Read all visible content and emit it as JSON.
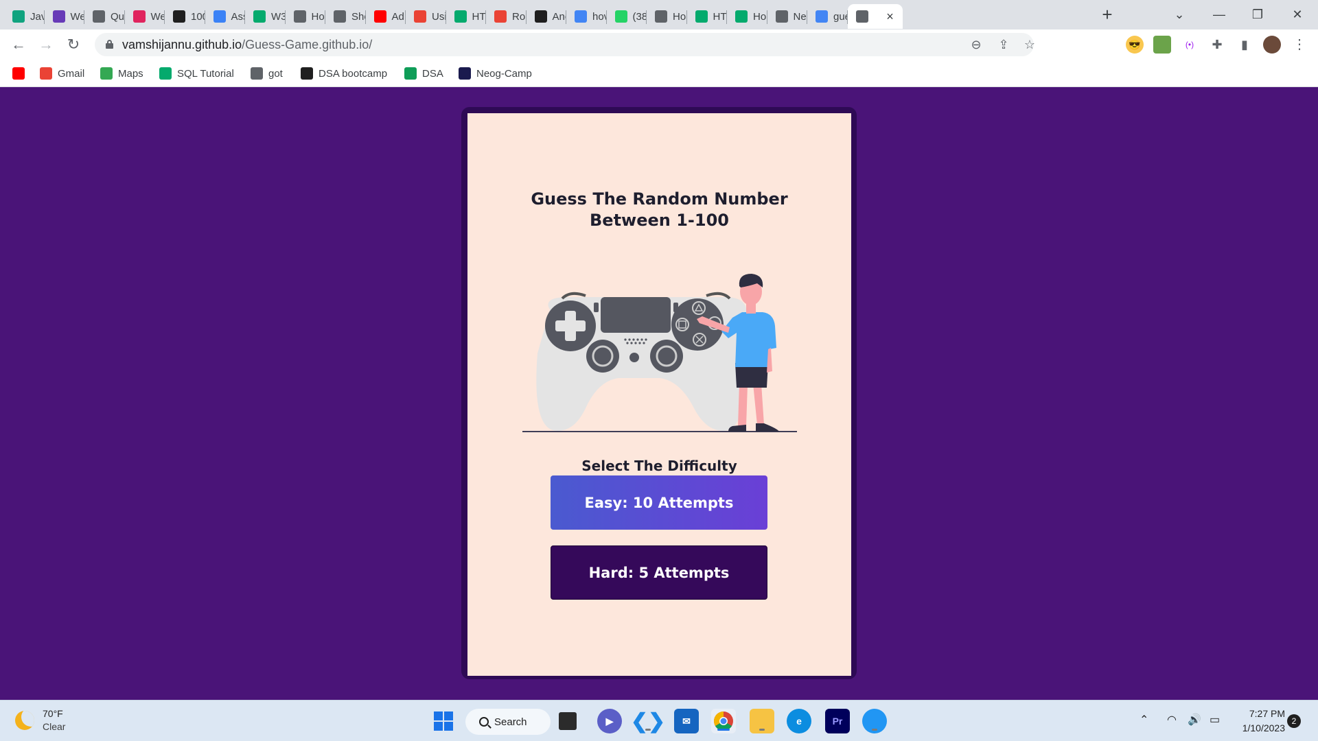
{
  "browser": {
    "tabs": [
      {
        "title": "Jav",
        "icon": "openai-icon",
        "color": "#10a37f"
      },
      {
        "title": "We",
        "icon": "form-icon",
        "color": "#673ab7"
      },
      {
        "title": "Qu",
        "icon": "globe-icon",
        "color": "#5f6368"
      },
      {
        "title": "We",
        "icon": "app-icon",
        "color": "#e0245e"
      },
      {
        "title": "100",
        "icon": "leetcode-icon",
        "color": "#1f1f1f"
      },
      {
        "title": "Ass",
        "icon": "bolt-icon",
        "color": "#3b82f6"
      },
      {
        "title": "W3",
        "icon": "w3schools-icon",
        "color": "#04aa6d"
      },
      {
        "title": "Ho",
        "icon": "globe-icon",
        "color": "#5f6368"
      },
      {
        "title": "Sho",
        "icon": "globe-icon",
        "color": "#5f6368"
      },
      {
        "title": "Ad",
        "icon": "youtube-icon",
        "color": "#ff0000"
      },
      {
        "title": "Usi",
        "icon": "puzzle-app-icon",
        "color": "#ea4335"
      },
      {
        "title": "HT",
        "icon": "w3schools-icon",
        "color": "#04aa6d"
      },
      {
        "title": "Rol",
        "icon": "puzzle-app-icon",
        "color": "#ea4335"
      },
      {
        "title": "Ano",
        "icon": "eh-icon",
        "color": "#1f1f1f"
      },
      {
        "title": "hov",
        "icon": "google-icon",
        "color": "#4285f4"
      },
      {
        "title": "(38",
        "icon": "whatsapp-icon",
        "color": "#25d366"
      },
      {
        "title": "Ho",
        "icon": "globe-icon",
        "color": "#5f6368"
      },
      {
        "title": "HT",
        "icon": "w3schools-icon",
        "color": "#04aa6d"
      },
      {
        "title": "Ho",
        "icon": "w3schools-icon",
        "color": "#04aa6d"
      },
      {
        "title": "Ne",
        "icon": "globe-icon",
        "color": "#5f6368"
      },
      {
        "title": "gue",
        "icon": "google-icon",
        "color": "#4285f4"
      },
      {
        "title": "",
        "icon": "globe-icon",
        "color": "#5f6368",
        "active": true
      }
    ],
    "url_host": "vamshijannu.github.io",
    "url_path": "/Guess-Game.github.io/",
    "bookmarks": [
      {
        "label": "",
        "icon": "youtube-icon",
        "color": "#ff0000"
      },
      {
        "label": "Gmail",
        "icon": "gmail-icon",
        "color": "#ea4335"
      },
      {
        "label": "Maps",
        "icon": "maps-pin-icon",
        "color": "#34a853"
      },
      {
        "label": "SQL Tutorial",
        "icon": "w3schools-icon",
        "color": "#04aa6d"
      },
      {
        "label": "got",
        "icon": "globe-icon",
        "color": "#5f6368"
      },
      {
        "label": "DSA bootcamp",
        "icon": "github-icon",
        "color": "#1f1f1f"
      },
      {
        "label": "DSA",
        "icon": "sheets-icon",
        "color": "#0f9d58"
      },
      {
        "label": "Neog-Camp",
        "icon": "neog-icon",
        "color": "#1a1a4e"
      }
    ]
  },
  "game": {
    "title_line1": "Guess The Random Number",
    "title_line2": "Between 1-100",
    "difficulty_label": "Select The Difficulty",
    "easy_label": "Easy: 10 Attempts",
    "hard_label": "Hard: 5 Attempts",
    "colors": {
      "page_bg": "#4a1478",
      "card_bg": "#fde7dc",
      "easy_start": "#4a5ad0",
      "easy_end": "#6a3fd6",
      "hard_bg": "#35095a"
    }
  },
  "taskbar": {
    "temperature": "70°F",
    "condition": "Clear",
    "search_label": "Search",
    "time": "7:27 PM",
    "date": "1/10/2023",
    "notification_count": "2"
  }
}
